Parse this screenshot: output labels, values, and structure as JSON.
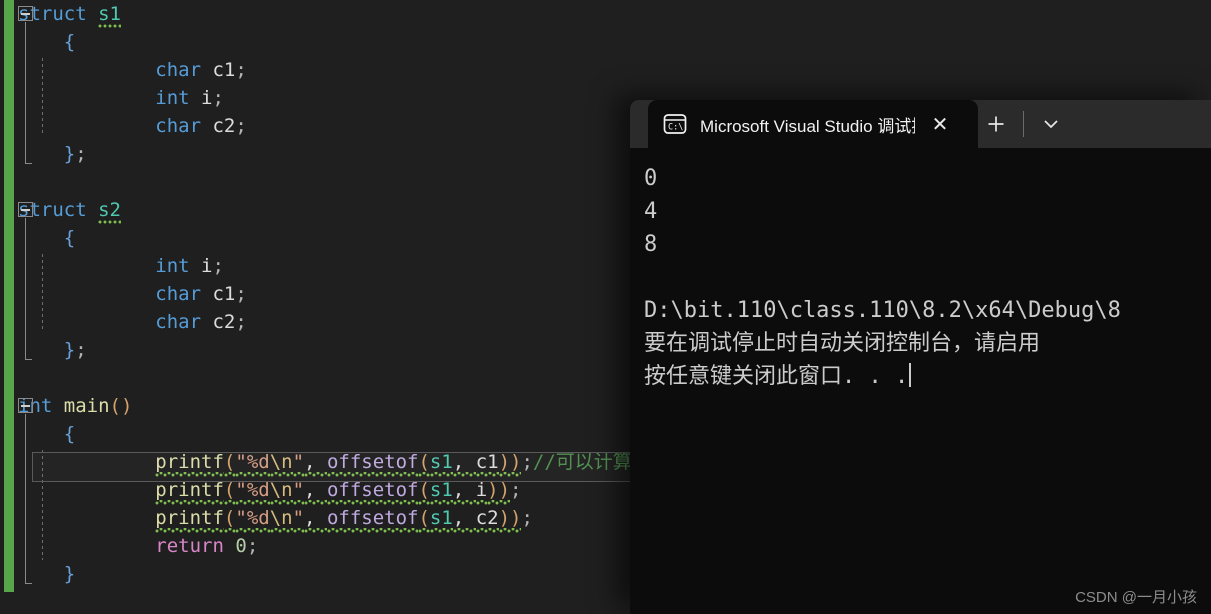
{
  "editor": {
    "change_bar_color": "#57a64a",
    "background": "#1f1f1f",
    "lines": [
      {
        "indent": 0,
        "tokens": [
          {
            "t": "struct",
            "c": "kw"
          },
          {
            "t": " ",
            "c": "ident"
          },
          {
            "t": "s1",
            "c": "type sq-dot"
          }
        ]
      },
      {
        "indent": 1,
        "tokens": [
          {
            "t": "{",
            "c": "brace"
          }
        ]
      },
      {
        "indent": 2,
        "tokens": [
          {
            "t": "char",
            "c": "kw"
          },
          {
            "t": " c1",
            "c": "ident"
          },
          {
            "t": ";",
            "c": "semi"
          }
        ]
      },
      {
        "indent": 2,
        "tokens": [
          {
            "t": "int",
            "c": "kw"
          },
          {
            "t": " i",
            "c": "ident"
          },
          {
            "t": ";",
            "c": "semi"
          }
        ]
      },
      {
        "indent": 2,
        "tokens": [
          {
            "t": "char",
            "c": "kw"
          },
          {
            "t": " c2",
            "c": "ident"
          },
          {
            "t": ";",
            "c": "semi"
          }
        ]
      },
      {
        "indent": 1,
        "tokens": [
          {
            "t": "}",
            "c": "brace"
          },
          {
            "t": ";",
            "c": "semi"
          }
        ]
      },
      {
        "indent": 0,
        "tokens": []
      },
      {
        "indent": 0,
        "tokens": [
          {
            "t": "struct",
            "c": "kw"
          },
          {
            "t": " ",
            "c": "ident"
          },
          {
            "t": "s2",
            "c": "type sq-dot"
          }
        ]
      },
      {
        "indent": 1,
        "tokens": [
          {
            "t": "{",
            "c": "brace"
          }
        ]
      },
      {
        "indent": 2,
        "tokens": [
          {
            "t": "int",
            "c": "kw"
          },
          {
            "t": " i",
            "c": "ident"
          },
          {
            "t": ";",
            "c": "semi"
          }
        ]
      },
      {
        "indent": 2,
        "tokens": [
          {
            "t": "char",
            "c": "kw"
          },
          {
            "t": " c1",
            "c": "ident"
          },
          {
            "t": ";",
            "c": "semi"
          }
        ]
      },
      {
        "indent": 2,
        "tokens": [
          {
            "t": "char",
            "c": "kw"
          },
          {
            "t": " c2",
            "c": "ident"
          },
          {
            "t": ";",
            "c": "semi"
          }
        ]
      },
      {
        "indent": 1,
        "tokens": [
          {
            "t": "}",
            "c": "brace"
          },
          {
            "t": ";",
            "c": "semi"
          }
        ]
      },
      {
        "indent": 0,
        "tokens": []
      },
      {
        "indent": 0,
        "tokens": [
          {
            "t": "int",
            "c": "kw"
          },
          {
            "t": " ",
            "c": "ident"
          },
          {
            "t": "main",
            "c": "fn"
          },
          {
            "t": "()",
            "c": "punc"
          }
        ]
      },
      {
        "indent": 1,
        "tokens": [
          {
            "t": "{",
            "c": "brace"
          }
        ]
      },
      {
        "indent": 2,
        "tokens": [
          {
            "t": "printf",
            "c": "fn sq"
          },
          {
            "t": "(",
            "c": "punc sq"
          },
          {
            "t": "\"%d",
            "c": "str sq"
          },
          {
            "t": "\\n",
            "c": "esc sq"
          },
          {
            "t": "\"",
            "c": "str sq"
          },
          {
            "t": ", ",
            "c": "ident sq"
          },
          {
            "t": "offsetof",
            "c": "macro sq"
          },
          {
            "t": "(",
            "c": "punc sq"
          },
          {
            "t": "s1",
            "c": "type sq"
          },
          {
            "t": ", ",
            "c": "ident sq"
          },
          {
            "t": "c1",
            "c": "ident sq"
          },
          {
            "t": "))",
            "c": "punc sq"
          },
          {
            "t": ";",
            "c": "semi"
          },
          {
            "t": "//可以计算偏移",
            "c": "cmt"
          }
        ]
      },
      {
        "indent": 2,
        "tokens": [
          {
            "t": "printf",
            "c": "fn sq"
          },
          {
            "t": "(",
            "c": "punc sq"
          },
          {
            "t": "\"%d",
            "c": "str sq"
          },
          {
            "t": "\\n",
            "c": "esc sq"
          },
          {
            "t": "\"",
            "c": "str sq"
          },
          {
            "t": ", ",
            "c": "ident sq"
          },
          {
            "t": "offsetof",
            "c": "macro sq"
          },
          {
            "t": "(",
            "c": "punc sq"
          },
          {
            "t": "s1",
            "c": "type sq"
          },
          {
            "t": ", ",
            "c": "ident sq"
          },
          {
            "t": "i",
            "c": "ident sq"
          },
          {
            "t": "))",
            "c": "punc sq"
          },
          {
            "t": ";",
            "c": "semi"
          }
        ]
      },
      {
        "indent": 2,
        "tokens": [
          {
            "t": "printf",
            "c": "fn sq"
          },
          {
            "t": "(",
            "c": "punc sq"
          },
          {
            "t": "\"%d",
            "c": "str sq"
          },
          {
            "t": "\\n",
            "c": "esc sq"
          },
          {
            "t": "\"",
            "c": "str sq"
          },
          {
            "t": ", ",
            "c": "ident sq"
          },
          {
            "t": "offsetof",
            "c": "macro sq"
          },
          {
            "t": "(",
            "c": "punc sq"
          },
          {
            "t": "s1",
            "c": "type sq"
          },
          {
            "t": ", ",
            "c": "ident sq"
          },
          {
            "t": "c2",
            "c": "ident sq"
          },
          {
            "t": "))",
            "c": "punc sq"
          },
          {
            "t": ";",
            "c": "semi"
          }
        ]
      },
      {
        "indent": 2,
        "tokens": [
          {
            "t": "return",
            "c": "ret"
          },
          {
            "t": " ",
            "c": "ident"
          },
          {
            "t": "0",
            "c": "num"
          },
          {
            "t": ";",
            "c": "semi"
          }
        ]
      },
      {
        "indent": 1,
        "tokens": [
          {
            "t": "}",
            "c": "brace"
          }
        ]
      }
    ]
  },
  "console": {
    "tab": {
      "icon": "console-cmd-icon",
      "title": "Microsoft Visual Studio 调试控",
      "close_label": "✕"
    },
    "new_tab_label": "+",
    "dropdown_label": "⌄",
    "output": {
      "values": [
        "0",
        "4",
        "8"
      ],
      "path_line": "D:\\bit.110\\class.110\\8.2\\x64\\Debug\\8",
      "hint_line": "要在调试停止时自动关闭控制台，请启用",
      "prompt_line": "按任意键关闭此窗口. . ."
    }
  },
  "watermark": "CSDN @一月小孩"
}
